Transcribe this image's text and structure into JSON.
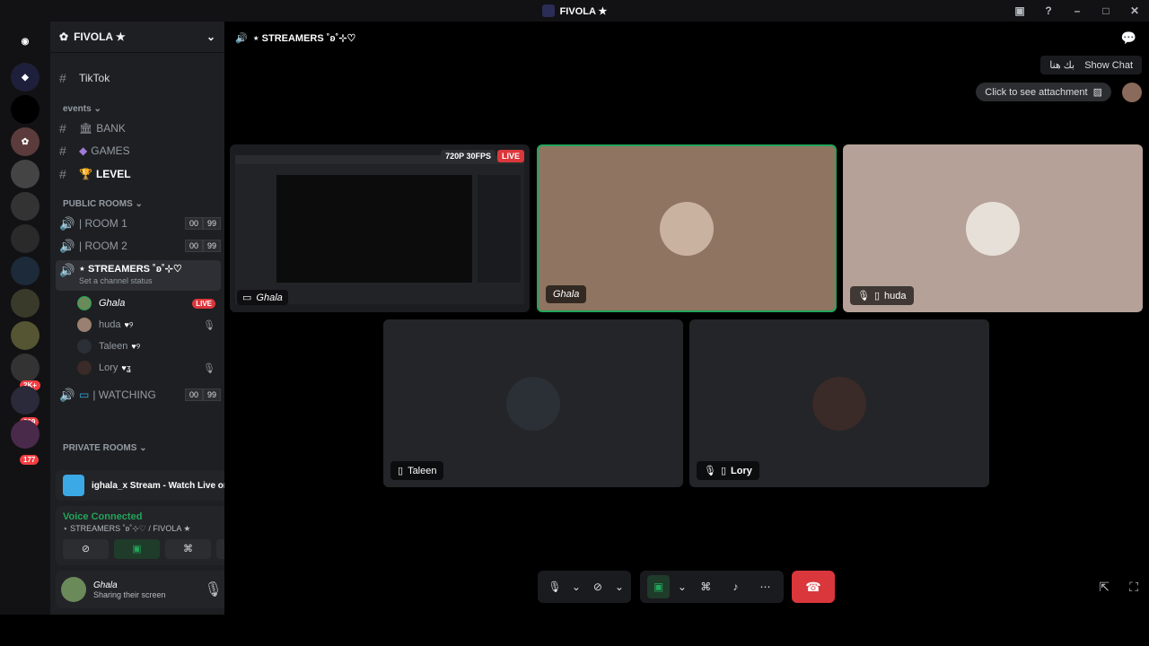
{
  "window": {
    "title": "FIVOLA ★"
  },
  "server_badges": {
    "b1": "2K+",
    "b2": "269",
    "b3": "177"
  },
  "sidebar": {
    "guild_name": "FIVOLA ★",
    "channels": [
      {
        "label": "TikTok"
      },
      {
        "label": "BANK"
      },
      {
        "label": "GAMES"
      },
      {
        "label": "LEVEL"
      }
    ],
    "category_events": "events",
    "category_public": "PUBLIC ROOMS",
    "category_private": "PRIVATE ROOMS",
    "rooms": [
      {
        "label": "| ROOM 1",
        "a": "00",
        "b": "99"
      },
      {
        "label": "| ROOM 2",
        "a": "00",
        "b": "99"
      }
    ],
    "active_channel": "⋆ STREAMERS ˚ʚ˚⊹♡",
    "active_status": "Set a channel status",
    "users": [
      {
        "name": "Ghala",
        "badge": "LIVE"
      },
      {
        "name": "huda",
        "suffix": "♥୨"
      },
      {
        "name": "Taleen",
        "suffix": "♥୨"
      },
      {
        "name": "Lory",
        "suffix": "♥ʓ"
      }
    ],
    "watching": {
      "label": "| WATCHING",
      "a": "00",
      "b": "99"
    },
    "stream_panel": "ighala_x Stream - Watch Live on Ki...",
    "voice": {
      "status": "Voice Connected",
      "channel": "⋆ STREAMERS ˚ʚ˚⊹♡ / FIVOLA ★"
    },
    "me": {
      "name": "Ghala",
      "status": "Sharing their screen"
    }
  },
  "main": {
    "channel_title": "⋆ STREAMERS ˚ʚ˚⊹♡",
    "tooltip_show_chat": "Show Chat",
    "tooltip_rtl": "بك هنا",
    "attachment": "Click to see attachment",
    "stream_quality": "720P 30FPS",
    "live": "LIVE",
    "tiles": [
      {
        "name": "Ghala"
      },
      {
        "name": "Ghala"
      },
      {
        "name": "huda"
      },
      {
        "name": "Taleen"
      },
      {
        "name": "Lory"
      }
    ]
  },
  "colors": {
    "accent_green": "#23a55a",
    "danger": "#da373c",
    "bg": "#000000"
  }
}
